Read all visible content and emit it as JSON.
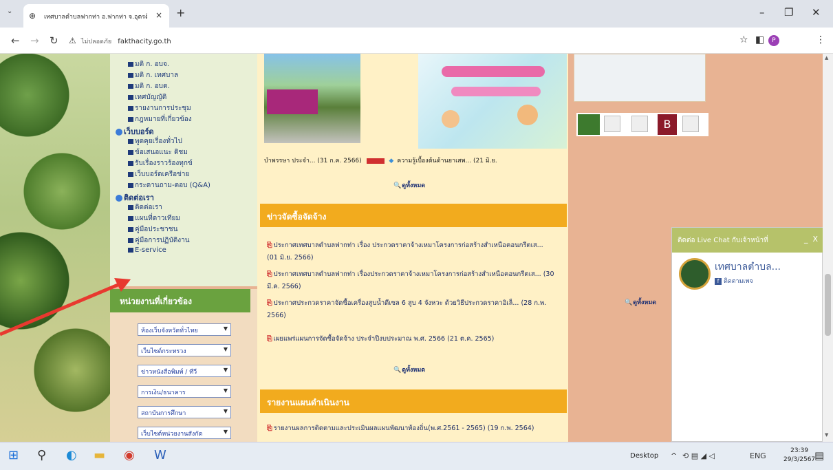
{
  "browser": {
    "tab_title": "เทศบาลตำบลฟากท่า อ.ฟากท่า จ.อุตรดิตถ์ - ...",
    "not_secure_label": "ไม่ปลอดภัย",
    "url": "fakthacity.go.th",
    "profile_initial": "P"
  },
  "left_menu": {
    "items_top": [
      "มติ ก. อบจ.",
      "มติ ก. เทศบาล",
      "มติ ก. อบต.",
      "เทศบัญญัติ",
      "รายงานการประชุม",
      "กฎหมายที่เกี่ยวข้อง"
    ],
    "webboard_head": "เว็บบอร์ด",
    "webboard_items": [
      "พูดคุยเรื่องทั่วไป",
      "ข้อเสนอแนะ ติชม",
      "รับเรื่องราวร้องทุกข์",
      "เว็บบอร์ดเครือข่าย",
      "กระดานถาม-ตอบ (Q&A)"
    ],
    "contact_head": "ติดต่อเรา",
    "contact_items": [
      "ติดต่อเรา",
      "แผนที่ดาวเทียม",
      "คู่มือประชาชน",
      "คู่มือการปฏิบัติงาน",
      "E-service"
    ]
  },
  "agencies": {
    "title": "หน่วยงานที่เกี่ยวข้อง",
    "selects": [
      "ห้องเว็บจังหวัดทั่วไทย",
      "เว็บไซต์กระทรวง",
      "ข่าวหนังสือพิมพ์ / ทีวี",
      "การเงิน/ธนาคาร",
      "สถาบันการศึกษา",
      "เว็บไซต์หน่วยงานสังกัด"
    ]
  },
  "news": {
    "item1": "บำพรรษา ประจำ... (31 ก.ค. 2566)",
    "item2": "ความรู้เบื้องต้นด้านยาเสพ... (21 มิ.ย.",
    "view_all": "ดูทั้งหมด"
  },
  "procurement": {
    "title": "ข่าวจัดซื้อจัดจ้าง",
    "items": [
      "ประกาศเทศบาลตำบลฟากท่า เรื่อง ประกวดราคาจ้างเหมาโครงการก่อสร้างสำเหนือคอนกรีตเส... (01 มิ.ย. 2566)",
      "ประกาศเทศบาลตำบลฟากท่า เรื่องประกวดราคาจ้างเหมาโครงการก่อสร้างสำเหนือคอนกรีตเส... (30 มี.ค. 2566)",
      "ประกาศประกวดราคาจัดซื้อเครื่องสูบน้ำดีเซล 6 สูบ 4 จังหวะ ด้วยวิธีประกวดราคาอิเล็... (28 ก.พ. 2566)",
      "เผยแพร่แผนการจัดซื้อจัดจ้าง ประจำปีงบประมาณ พ.ศ. 2566 (21 ต.ค. 2565)"
    ],
    "view_all": "ดูทั้งหมด"
  },
  "report": {
    "title": "รายงานแผนดำเนินงาน",
    "item": "รายงานผลการติดตามและประเมินผลแผนพัฒนาท้องถิ่น(พ.ศ.2561 - 2565) (19 ก.พ. 2564)"
  },
  "right_col": {
    "view_all": "ดูทั้งหมด",
    "badge_text": "B"
  },
  "chat": {
    "title": "ติดต่อ Live Chat กับเจ้าหน้าที่",
    "page_name": "เทศบาลตำบล...",
    "follow": "ติดตามเพจ"
  },
  "taskbar": {
    "desktop_label": "Desktop",
    "lang": "ENG",
    "time": "23:39",
    "date": "29/3/2567"
  }
}
